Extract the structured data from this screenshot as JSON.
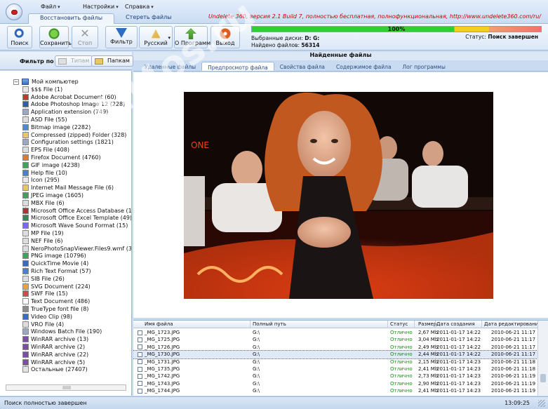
{
  "menu": {
    "file": "Файл",
    "settings": "Настройки",
    "help": "Справка"
  },
  "window_title": "Undelete 360, версия 2.1 Build 7, полностью бесплатная, полнофункциональная, http://www.undelete360.com/ru/",
  "tabs": {
    "restore": "Восстановить файлы",
    "sites": "Стереть файлы"
  },
  "toolbar": {
    "search": "Поиск",
    "save": "Сохранить",
    "stop": "Стоп",
    "filter": "Фильтр",
    "language": "Русский",
    "about": "О Программе",
    "exit": "Выход"
  },
  "progress": {
    "value": 1.0,
    "label": "100%"
  },
  "info": {
    "disks_label": "Выбранные диски:",
    "disks_value": "D: G:",
    "found_label": "Найдено файлов:",
    "found_value": "56314",
    "status_label": "Статус:",
    "status_value": "Поиск завершен"
  },
  "filter": {
    "title": "Фильтр по",
    "by_type": "Типам",
    "by_folder": "Папкам"
  },
  "tree": {
    "root": "Мой компьютер",
    "items": [
      "$$$ File (1)",
      "Adobe Acrobat Document (60)",
      "Adobe Photoshop Image 12 (228)",
      "Application extension (749)",
      "ASD File (55)",
      "Bitmap image (2282)",
      "Compressed (zipped) Folder (328)",
      "Configuration settings (1821)",
      "EPS File (408)",
      "Firefox Document (4760)",
      "GIF image (4238)",
      "Help file (10)",
      "Icon (295)",
      "Internet Mail Message File (6)",
      "JPEG image (1605)",
      "MBX File (6)",
      "Microsoft Office Access Database (13)",
      "Microsoft Office Excel Template (49)",
      "Microsoft Wave Sound Format (15)",
      "MP File (19)",
      "NEF File (6)",
      "NeroPhotoSnapViewer.Files9.wmf (3)",
      "PNG image (10796)",
      "QuickTime Movie (4)",
      "Rich Text Format (57)",
      "SIB File (26)",
      "SVG Document (224)",
      "SWF File (15)",
      "Text Document (486)",
      "TrueType font file (8)",
      "Video Clip (98)",
      "VRO File (4)",
      "Windows Batch File (190)",
      "WinRAR archive (13)",
      "WinRAR archive (2)",
      "WinRAR archive (22)",
      "WinRAR archive (5)",
      "Остальные (27407)"
    ]
  },
  "panel": {
    "title": "Найденные файлы",
    "tabs": [
      "Удаленные файлы",
      "Предпросмотр файла",
      "Свойства файла",
      "Содержимое файла",
      "Лог программы"
    ]
  },
  "grid": {
    "columns": [
      "Имя файла",
      "Полный путь",
      "Статус",
      "Размер",
      "Дата создания",
      "Дата редактирования"
    ],
    "rows": [
      [
        "_MG_1723.JPG",
        "G:\\",
        "Отлично",
        "2,67 Mb",
        "2011-01-17 14:22",
        "2010-06-21 11:17"
      ],
      [
        "_MG_1725.JPG",
        "G:\\",
        "Отлично",
        "3,04 Mb",
        "2011-01-17 14:22",
        "2010-06-21 11:17"
      ],
      [
        "_MG_1726.JPG",
        "G:\\",
        "Отлично",
        "2,49 Mb",
        "2011-01-17 14:22",
        "2010-06-21 11:17"
      ],
      [
        "_MG_1730.JPG",
        "G:\\",
        "Отлично",
        "2,44 Mb",
        "2011-01-17 14:22",
        "2010-06-21 11:17"
      ],
      [
        "_MG_1731.JPG",
        "G:\\",
        "Отлично",
        "2,15 Mb",
        "2011-01-17 14:23",
        "2010-06-21 11:18"
      ],
      [
        "_MG_1735.JPG",
        "G:\\",
        "Отлично",
        "2,41 Mb",
        "2011-01-17 14:23",
        "2010-06-21 11:18"
      ],
      [
        "_MG_1742.JPG",
        "G:\\",
        "Отлично",
        "2,73 Mb",
        "2011-01-17 14:23",
        "2010-06-21 11:19"
      ],
      [
        "_MG_1743.JPG",
        "G:\\",
        "Отлично",
        "2,90 Mb",
        "2011-01-17 14:23",
        "2010-06-21 11:19"
      ],
      [
        "_MG_1744.JPG",
        "G:\\",
        "Отлично",
        "2,41 Mb",
        "2011-01-17 14:23",
        "2010-06-21 11:19"
      ],
      [
        "_MG_1747.JPG",
        "G:\\",
        "Отлично",
        "2,54 Mb",
        "2011-01-17 14:23",
        "2010-06-21 11:19"
      ]
    ]
  },
  "statusbar": {
    "text": "Поиск полностью завершен",
    "time": "13:09:25"
  },
  "watermark": "All4os.ru"
}
